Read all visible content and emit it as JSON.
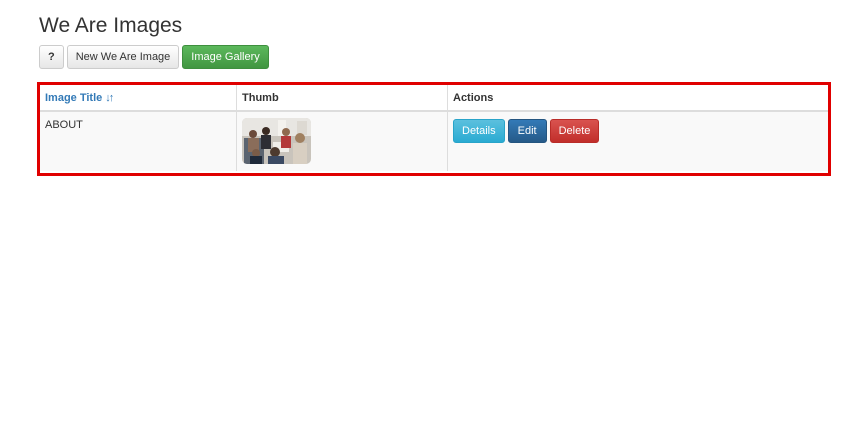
{
  "header": {
    "title": "We Are Images"
  },
  "toolbar": {
    "help_label": "?",
    "new_label": "New We Are Image",
    "gallery_label": "Image Gallery"
  },
  "table": {
    "columns": {
      "title": "Image Title",
      "thumb": "Thumb",
      "actions": "Actions"
    },
    "sort_icon": "sort-icon",
    "rows": [
      {
        "title": "ABOUT",
        "thumb_icon": "photo-thumbnail-icon",
        "details_label": "Details",
        "edit_label": "Edit",
        "delete_label": "Delete"
      }
    ]
  },
  "colors": {
    "highlight": "#e00000",
    "link": "#337ab7",
    "success": "#5cb85c",
    "info": "#5bc0de",
    "primary": "#337ab7",
    "danger": "#d9534f"
  }
}
